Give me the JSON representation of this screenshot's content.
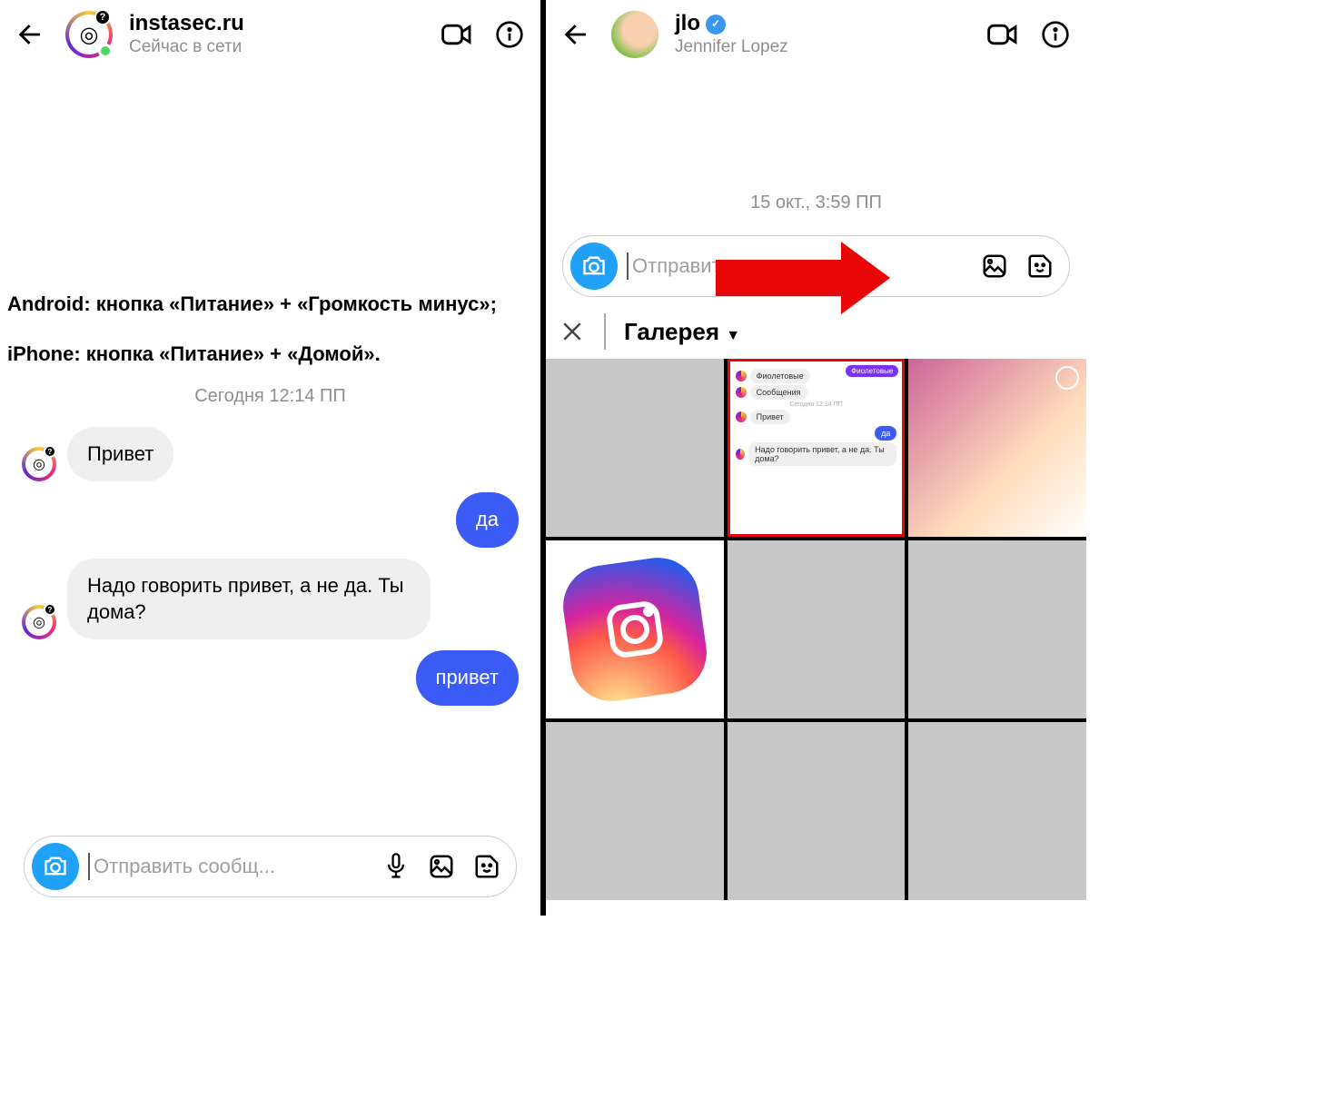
{
  "left": {
    "username": "instasec.ru",
    "status": "Сейчас в сети",
    "instructions_android": "Android: кнопка «Питание» + «Громкость минус»;",
    "instructions_iphone": "iPhone: кнопка «Питание» + «Домой».",
    "timestamp": "Сегодня 12:14 ПП",
    "msg1": "Привет",
    "msg2": "да",
    "msg3": "Надо говорить привет, а не да. Ты дома?",
    "msg4": "привет",
    "compose_placeholder": "Отправить сообщ..."
  },
  "right": {
    "username": "jlo",
    "subtitle": "Jennifer Lopez",
    "timestamp": "15 окт., 3:59 ПП",
    "compose_placeholder": "Отправить",
    "gallery_label": "Галерея",
    "mini": {
      "tag": "Фиолетовые",
      "m1": "Фиолетовые",
      "m2": "Сообщения",
      "ts": "Сегодня 12:14 ПП",
      "m3": "Привет",
      "m4": "да",
      "m5": "Надо говорить привет, а не да. Ты дома?"
    }
  }
}
